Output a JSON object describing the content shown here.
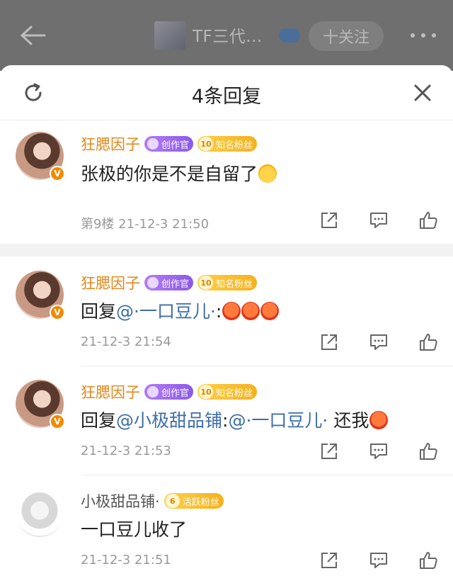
{
  "topbar": {
    "title": "TF三代...",
    "follow_label": "十关注"
  },
  "sheet": {
    "title": "4条回复"
  },
  "comments": [
    {
      "name": "狂腮因子",
      "badge_create": "创作官",
      "badge_fan_level": "10",
      "badge_fan": "知名粉丝",
      "text": "张极的你是不是自留了",
      "meta": "第9楼  21-12-3 21:50"
    },
    {
      "name": "狂腮因子",
      "badge_create": "创作官",
      "badge_fan_level": "10",
      "badge_fan": "知名粉丝",
      "prefix": "回复",
      "mention": "@·一口豆儿·",
      "rest": ":",
      "meta": "21-12-3 21:54"
    },
    {
      "name": "狂腮因子",
      "badge_create": "创作官",
      "badge_fan_level": "10",
      "badge_fan": "知名粉丝",
      "prefix": "回复",
      "mention": "@小极甜品铺",
      "rest": ":",
      "mention2": "@·一口豆儿·",
      "rest2": " 还我",
      "meta": "21-12-3 21:53"
    },
    {
      "name": "小极甜品铺·",
      "badge_fan_level": "6",
      "badge_fan": "活跃粉丝",
      "text": "一口豆儿收了",
      "meta": "21-12-3 21:51"
    }
  ],
  "colors": {
    "accent_name": "#e3871a",
    "mention": "#3d6ea8",
    "meta": "#9a9a9a"
  },
  "icons": [
    "back-arrow-icon",
    "more-icon",
    "refresh-icon",
    "close-icon",
    "share-icon",
    "comment-icon",
    "like-icon",
    "verified-v-icon"
  ]
}
